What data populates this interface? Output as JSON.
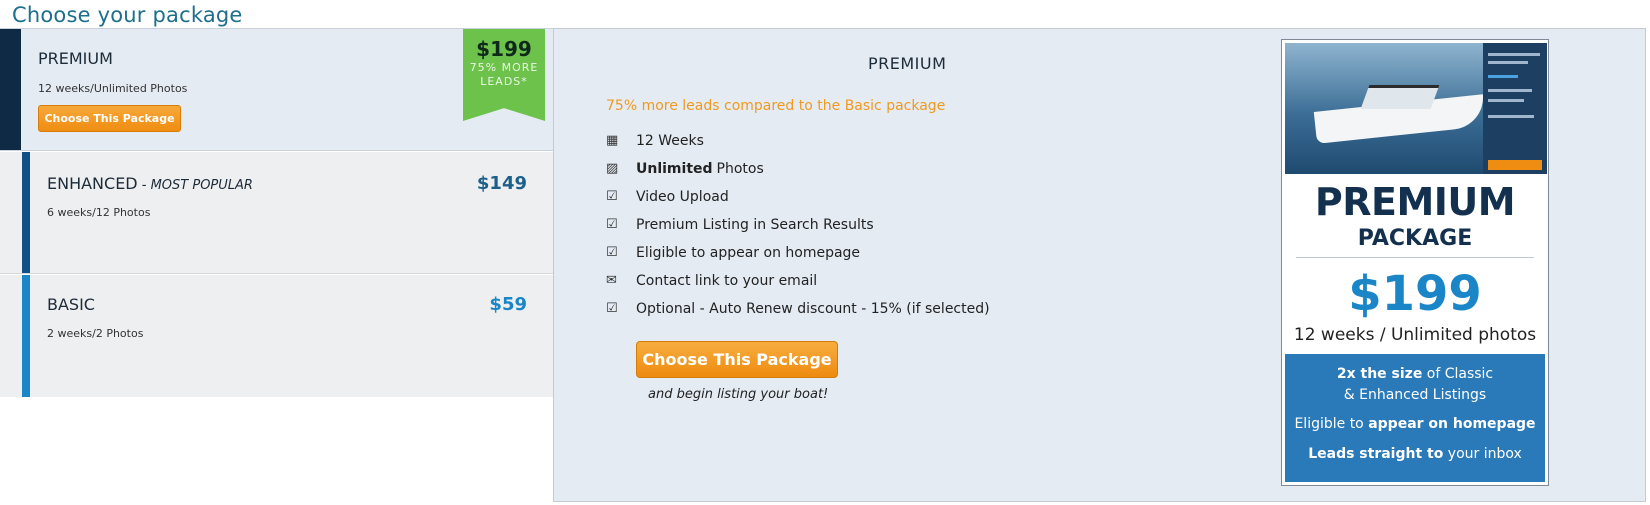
{
  "page_title": "Choose your package",
  "packages": {
    "premium": {
      "name": "PREMIUM",
      "desc": "12 weeks/Unlimited Photos",
      "button": "Choose This Package",
      "ribbon_price": "$199",
      "ribbon_line1": "75% MORE",
      "ribbon_line2": "LEADS*"
    },
    "enhanced": {
      "name": "ENHANCED",
      "tag": " - MOST POPULAR",
      "desc": "6 weeks/12 Photos",
      "price": "$149"
    },
    "basic": {
      "name": "BASIC",
      "desc": "2 weeks/2 Photos",
      "price": "$59"
    }
  },
  "detail": {
    "title": "PREMIUM",
    "subtitle": "75% more leads compared to the Basic package",
    "features": [
      {
        "icon": "calendar-icon",
        "glyph": "▦",
        "bold": "",
        "text": "12 Weeks"
      },
      {
        "icon": "image-icon",
        "glyph": "▨",
        "bold": "Unlimited",
        "text": "Photos"
      },
      {
        "icon": "checkbox-icon",
        "glyph": "☑",
        "bold": "",
        "text": "Video Upload"
      },
      {
        "icon": "checkbox-icon",
        "glyph": "☑",
        "bold": "",
        "text": "Premium Listing in Search Results"
      },
      {
        "icon": "checkbox-icon",
        "glyph": "☑",
        "bold": "",
        "text": "Eligible to appear on homepage"
      },
      {
        "icon": "envelope-icon",
        "glyph": "✉",
        "bold": "",
        "text": "Contact link to your email"
      },
      {
        "icon": "checkbox-icon",
        "glyph": "☑",
        "bold": "",
        "text": "Optional - Auto Renew discount - 15% (if selected)"
      }
    ],
    "button": "Choose This Package",
    "begin": "and begin listing your boat!"
  },
  "promo": {
    "headline": "PREMIUM",
    "subheadline": "PACKAGE",
    "price": "$199",
    "term": "12 weeks / Unlimited photos",
    "line1_bold": "2x the size",
    "line1_rest": " of Classic",
    "line2": "& Enhanced Listings",
    "line3_pre": "Eligible to ",
    "line3_bold": "appear on homepage",
    "line4_bold": "Leads straight to",
    "line4_rest": " your inbox"
  },
  "colors": {
    "accent_orange": "#ef8d12",
    "navy": "#0f2a45",
    "blue": "#1a86c8",
    "green_ribbon": "#6cc24a"
  }
}
